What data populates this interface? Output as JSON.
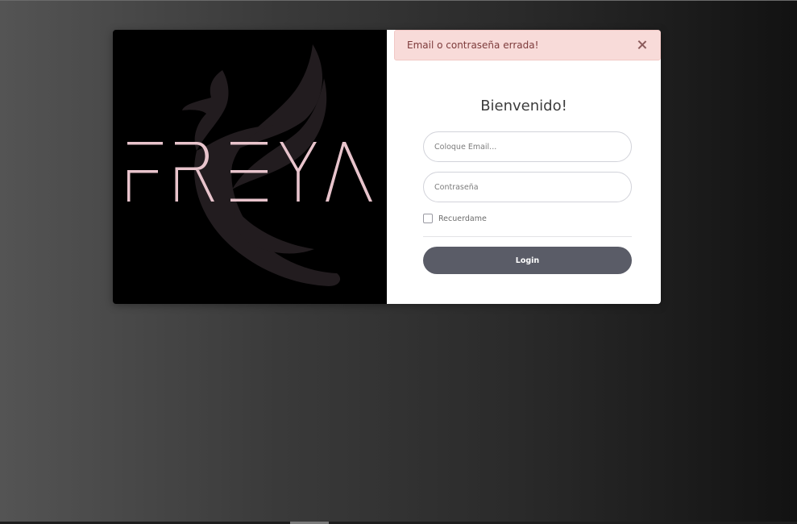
{
  "brand": {
    "logo_text": "FREYA",
    "background_color": "#000000",
    "logo_color": "#e8c4cc",
    "emblem": "phoenix-bird-icon"
  },
  "alert": {
    "message": "Email o contraseña errada!",
    "close_icon": "close-icon",
    "background_color": "#f8dbd9",
    "text_color": "#7d3b3b"
  },
  "login": {
    "title": "Bienvenido!",
    "email_placeholder": "Coloque Email...",
    "email_value": "",
    "password_placeholder": "Contraseña",
    "password_value": "",
    "remember_label": "Recuerdame",
    "remember_checked": false,
    "submit_label": "Login",
    "submit_color": "#5a5c67"
  }
}
